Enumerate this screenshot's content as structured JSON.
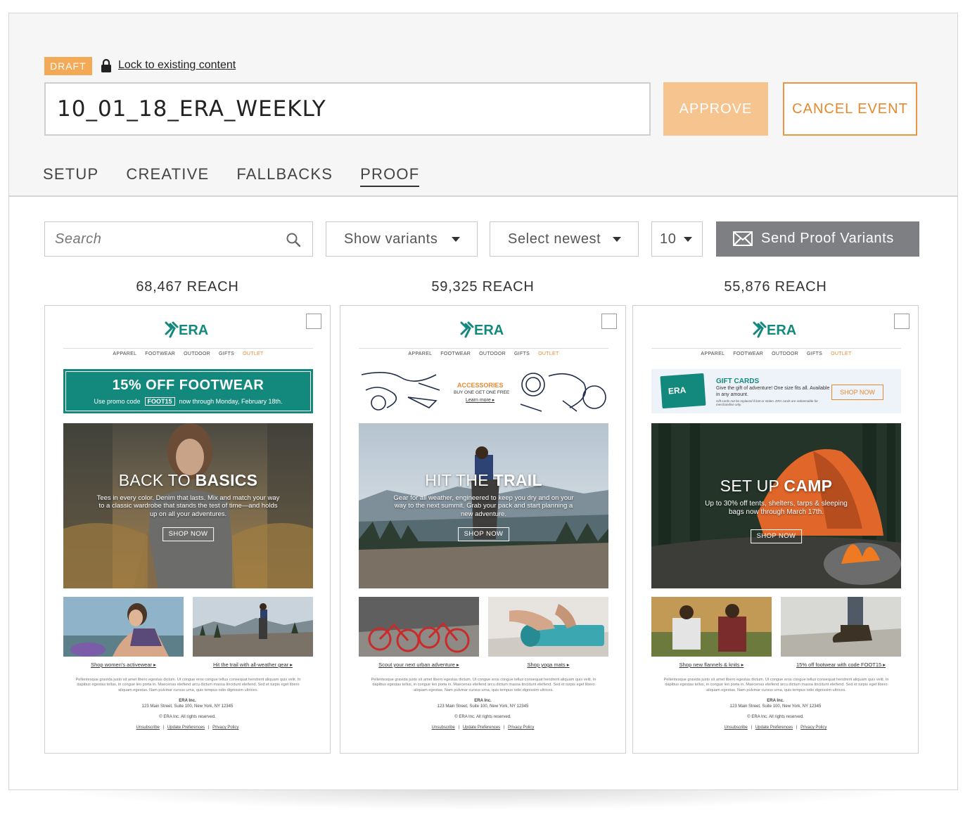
{
  "header": {
    "status_badge": "DRAFT",
    "lock_link": "Lock to existing content",
    "title_value": "10_01_18_ERA_WEEKLY",
    "approve_label": "APPROVE",
    "cancel_label": "CANCEL EVENT",
    "tabs": [
      {
        "label": "SETUP",
        "active": false
      },
      {
        "label": "CREATIVE",
        "active": false
      },
      {
        "label": "FALLBACKS",
        "active": false
      },
      {
        "label": "PROOF",
        "active": true
      }
    ]
  },
  "toolbar": {
    "search_placeholder": "Search",
    "show_variants": "Show variants",
    "select_newest": "Select newest",
    "count": "10",
    "send_label": "Send Proof Variants"
  },
  "icons": {
    "lock": "lock-icon",
    "search": "search-icon",
    "caret": "caret-down-icon",
    "mail": "envelope-icon",
    "checkbox": "checkbox"
  },
  "colors": {
    "accent_orange": "#f4a957",
    "approve_bg": "#f6c48f",
    "cancel_text": "#e8882c",
    "send_bg": "#7d7f82",
    "era_teal": "#13897e"
  },
  "variants": [
    {
      "reach": "68,467 REACH",
      "brand": "ERA",
      "nav": [
        "APPAREL",
        "FOOTWEAR",
        "OUTDOOR",
        "GIFTS",
        "OUTLET"
      ],
      "banner": {
        "headline": "15% OFF FOOTWEAR",
        "pre": "Use promo code",
        "code": "FOOT15",
        "post": "now through Monday, February 18th."
      },
      "hero": {
        "title_light": "BACK TO ",
        "title_bold": "BASICS",
        "desc": "Tees in every color. Denim that lasts. Mix and match your way to a classic wardrobe that stands the test of time—and holds up on all your adventures.",
        "button": "SHOP NOW"
      },
      "links": [
        "Shop women's activewear ▸",
        "Hit the trail with all-weather gear ▸"
      ]
    },
    {
      "reach": "59,325 REACH",
      "brand": "ERA",
      "nav": [
        "APPAREL",
        "FOOTWEAR",
        "OUTDOOR",
        "GIFTS",
        "OUTLET"
      ],
      "banner": {
        "headline": "ACCESSORIES",
        "sub": "BUY ONE GET ONE FREE",
        "link": "Learn more ▸"
      },
      "hero": {
        "title_light": "HIT THE ",
        "title_bold": "TRAIL",
        "desc": "Gear for all weather, engineered to keep you dry and on your way to the next summit. Grab your pack and start planning a new adventure.",
        "button": "SHOP NOW"
      },
      "links": [
        "Scout your next urban adventure ▸",
        "Shop yoga mats ▸"
      ]
    },
    {
      "reach": "55,876 REACH",
      "brand": "ERA",
      "nav": [
        "APPAREL",
        "FOOTWEAR",
        "OUTDOOR",
        "GIFTS",
        "OUTLET"
      ],
      "banner": {
        "card_brand": "ERA",
        "headline": "GIFT CARDS",
        "desc": "Give the gift of adventure! One size fits all. Available in any amount.",
        "small": "Gift cards not be replaced if lost or stolen. ERA cards are redeemable for merchandise only.",
        "button": "SHOP NOW"
      },
      "hero": {
        "title_light": "SET UP ",
        "title_bold": "CAMP",
        "desc": "Up to 30% off tents, shelters, tarps & sleeping bags now through March 17th.",
        "button": "SHOP NOW"
      },
      "links": [
        "Shop new flannels & knits ▸",
        "15% off footwear with code FOOT15 ▸"
      ]
    }
  ],
  "footer": {
    "lorem": "Pellentesque gravida justo sit amet libero egestas dictum. Ut congue eros congue tellus consequat hendrerit aliquam quis velit. In dapibus egestas tellus, in congue leo porta in. Maecenas eleifend arcu dictum massa tincidunt eleifend. Sed et turpis eget libero aliquam egestas. Nam pulvinar cursus urna, quis tempus odio dignissim ultrices.",
    "company": "ERA Inc.",
    "address": "123 Main Street, Suite 100, New York, NY 12345",
    "rights": "© ERA Inc. All rights reserved.",
    "unsubscribe": "Unsubscribe",
    "update": "Update Preferences",
    "privacy": "Privacy Policy",
    "sep": "|"
  }
}
